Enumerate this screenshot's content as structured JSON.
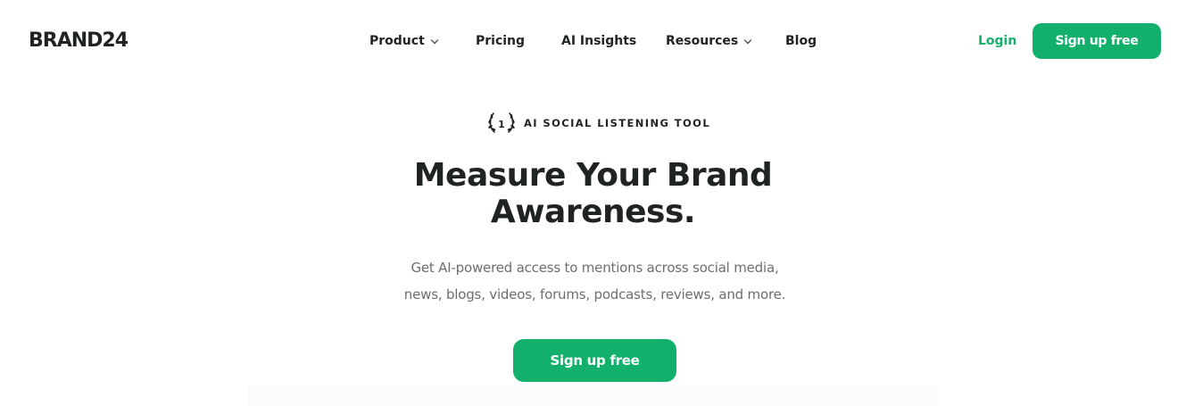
{
  "header": {
    "logo": "BRAND24",
    "nav": [
      {
        "label": "Product",
        "has_dropdown": true
      },
      {
        "label": "Pricing",
        "has_dropdown": false
      },
      {
        "label": "AI Insights",
        "has_dropdown": false
      },
      {
        "label": "Resources",
        "has_dropdown": true
      },
      {
        "label": "Blog",
        "has_dropdown": false
      }
    ],
    "login_label": "Login",
    "signup_label": "Sign up free"
  },
  "hero": {
    "badge_number": "1",
    "badge_text": "AI SOCIAL LISTENING TOOL",
    "headline_line1": "Measure Your Brand",
    "headline_line2": "Awareness.",
    "subtext_line1": "Get AI-powered access to mentions across social media,",
    "subtext_line2": "news, blogs, videos, forums, podcasts, reviews, and more.",
    "cta_label": "Sign up free"
  },
  "colors": {
    "accent": "#13b06b",
    "text_dark": "#1f2421",
    "text_muted": "#6b6f6d",
    "background": "#ffffff"
  },
  "icons": [
    "chevron-down-icon",
    "laurel-badge-icon"
  ]
}
